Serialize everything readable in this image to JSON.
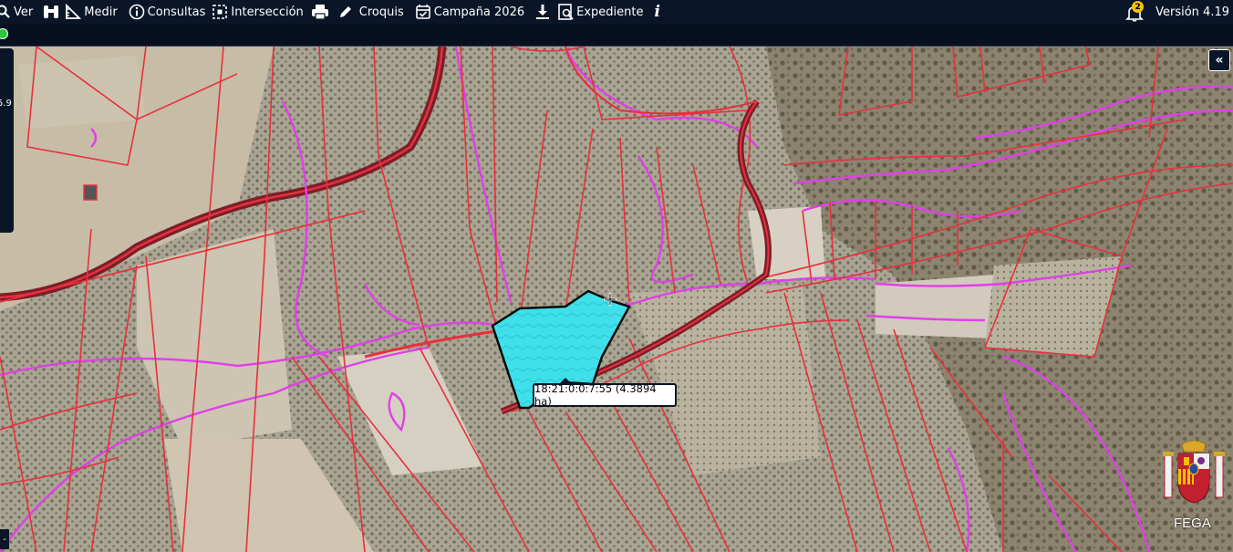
{
  "toolbar": {
    "ver_label": "Ver",
    "medir_label": "Medir",
    "consultas_label": "Consultas",
    "interseccion_label": "Intersección",
    "croquis_label": "Croquis",
    "campana_label": "Campaña 2026",
    "expediente_label": "Expediente",
    "notification_count": "2",
    "version_label": "Versión 4.19"
  },
  "side_panel": {
    "value": "5.9"
  },
  "map": {
    "collapse_label": "«",
    "tooltip_text": "18:21:0:0:7:55 (4.3894 ha)",
    "brand_label": "FEGA",
    "corner_label": "-"
  },
  "colors": {
    "toolbar_bg": "#0a1628",
    "parcel_line": "#e8303e",
    "recinto_line": "#e040e8",
    "selected_fill": "#3fe0ea",
    "status_ok": "#25c93a",
    "badge": "#f5c000"
  },
  "icons": {
    "ver": "magnifier-icon",
    "binoculars": "binoculars-icon",
    "medir": "ruler-icon",
    "consultas": "info-circle-icon",
    "interseccion": "dashed-square-icon",
    "print": "printer-icon",
    "croquis": "pencil-icon",
    "campana": "calendar-check-icon",
    "download": "download-icon",
    "expediente": "search-document-icon",
    "info": "italic-i-icon",
    "notifications": "bell-icon"
  }
}
